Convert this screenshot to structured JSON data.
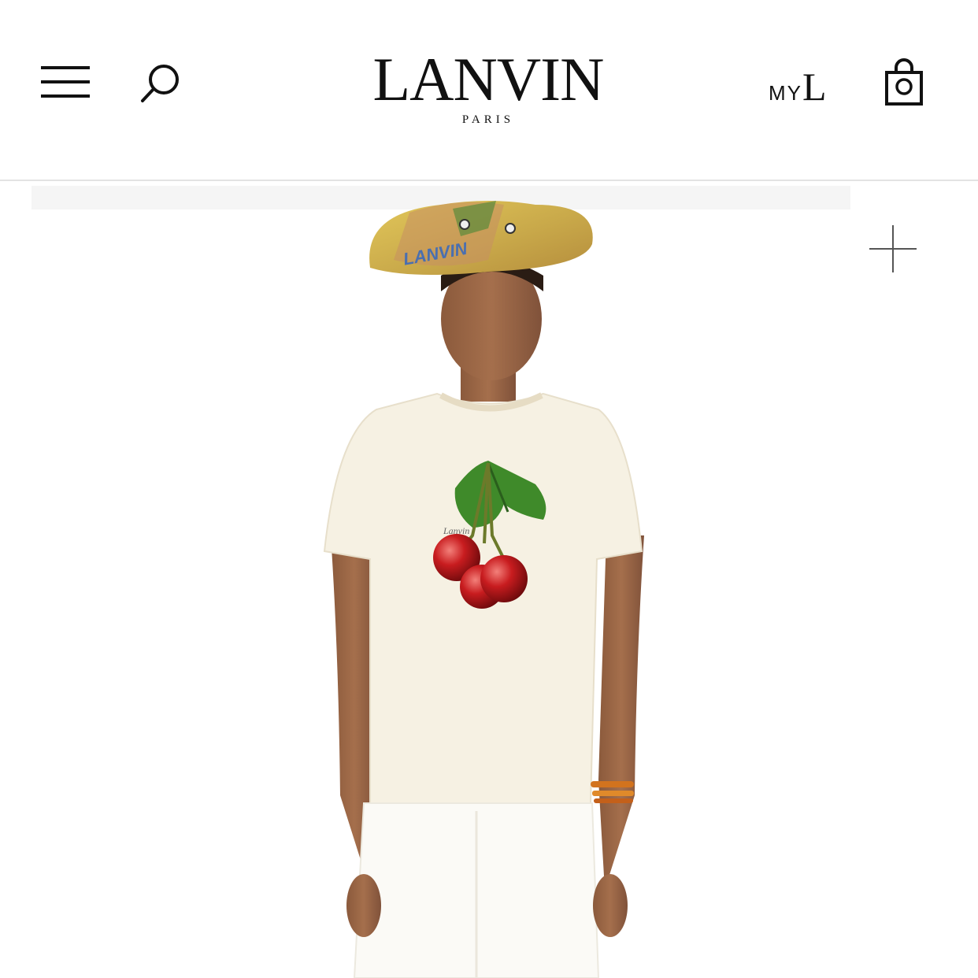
{
  "header": {
    "brand": "LANVIN",
    "brand_sub": "PARIS",
    "account_my": "MY",
    "account_l": "L"
  },
  "icons": {
    "menu": "hamburger-menu-icon",
    "search": "search-icon",
    "account": "my-lanvin-icon",
    "bag": "shopping-bag-icon",
    "zoom": "plus-icon"
  },
  "product_image": {
    "hat_print": "LANVIN",
    "chest_print": "Lanvin"
  },
  "colors": {
    "text": "#111111",
    "divider": "#e3e3e3",
    "tshirt": "#f6f1e3",
    "cherry": "#c81c1f",
    "leaf": "#3f8a2a",
    "hat": "#d7b74a"
  }
}
